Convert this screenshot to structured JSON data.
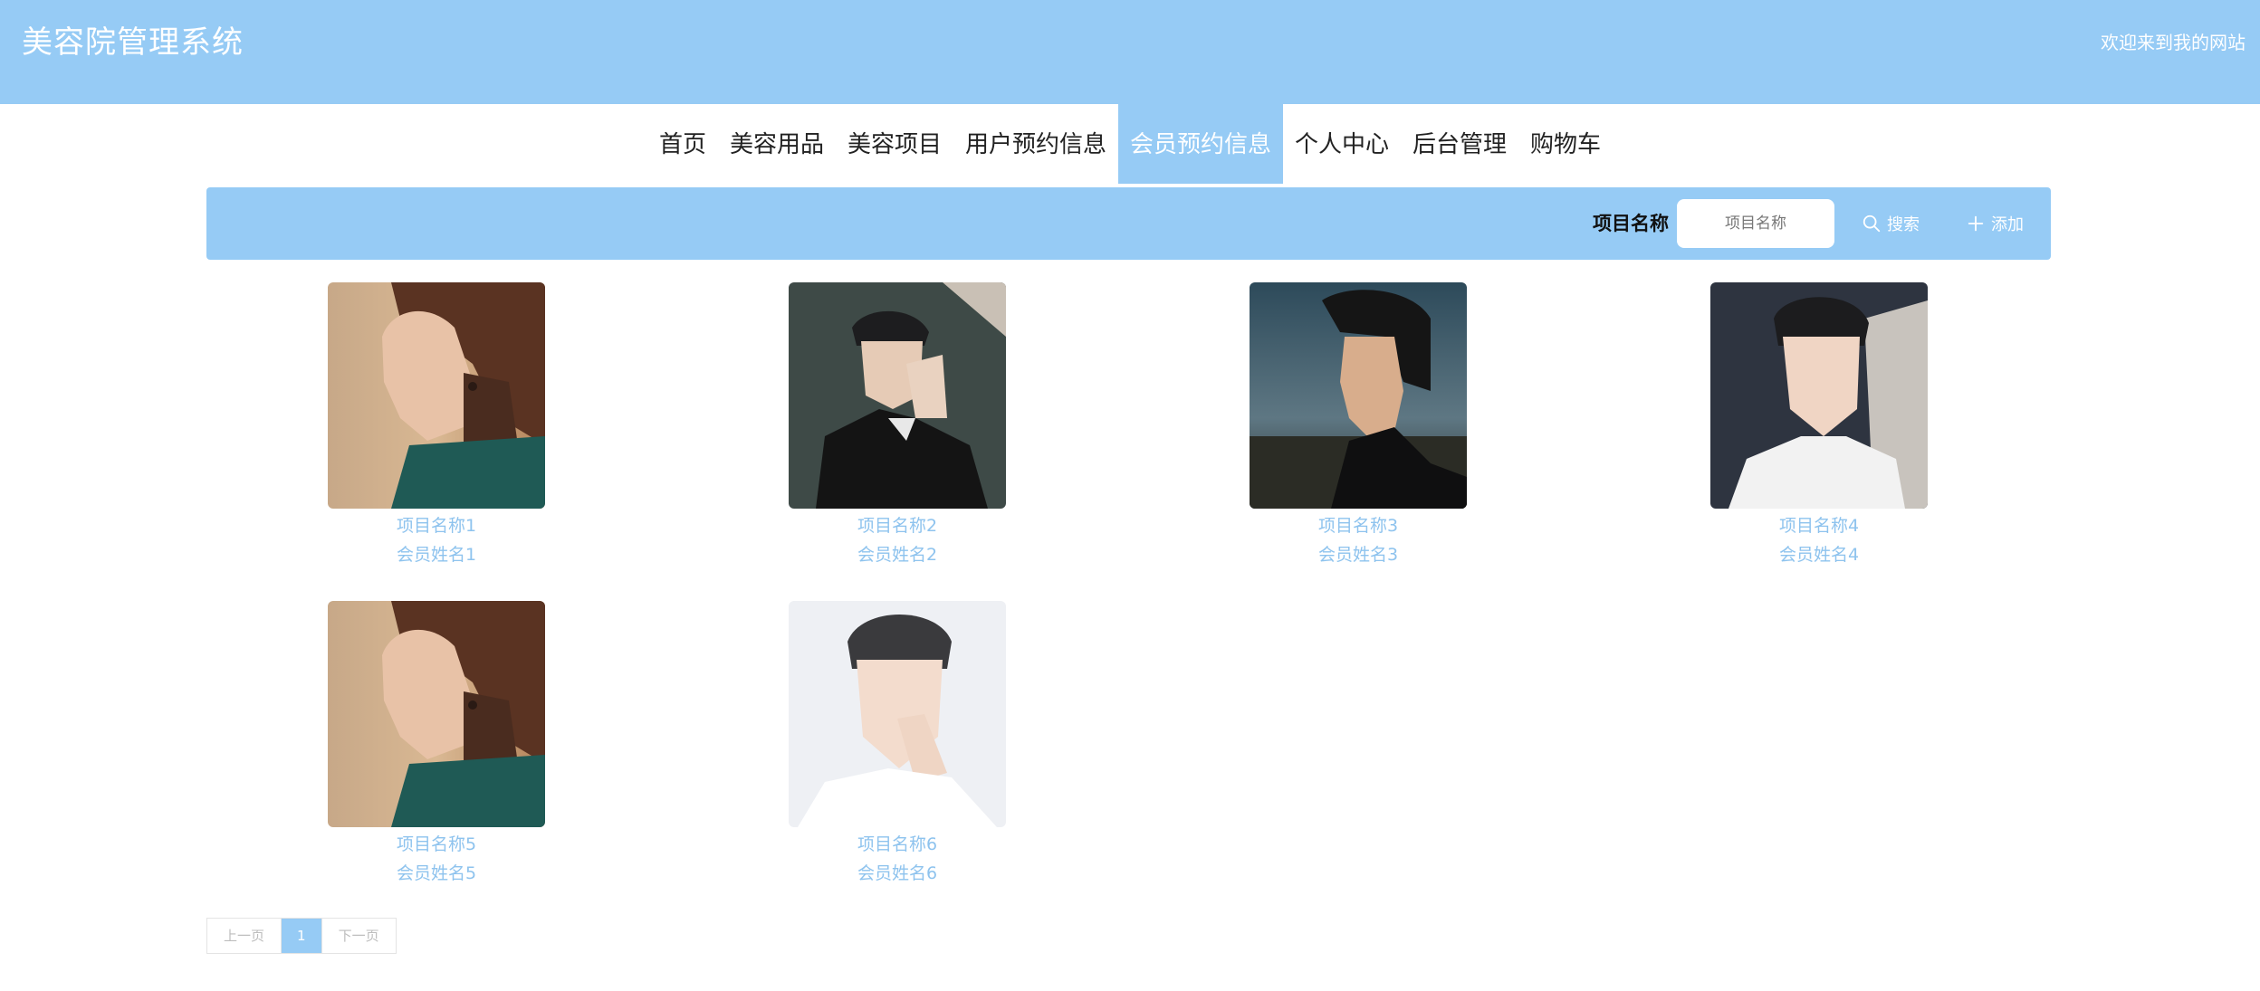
{
  "header": {
    "title": "美容院管理系统",
    "welcome": "欢迎来到我的网站"
  },
  "nav": {
    "items": [
      {
        "label": "首页"
      },
      {
        "label": "美容用品"
      },
      {
        "label": "美容项目"
      },
      {
        "label": "用户预约信息"
      },
      {
        "label": "会员预约信息"
      },
      {
        "label": "个人中心"
      },
      {
        "label": "后台管理"
      },
      {
        "label": "购物车"
      }
    ],
    "active": "会员预约信息"
  },
  "search": {
    "label": "项目名称",
    "placeholder": "项目名称",
    "search_label": "搜索",
    "add_label": "添加",
    "search_icon": "search-icon",
    "add_icon": "plus-icon"
  },
  "cards": [
    {
      "project": "项目名称1",
      "member": "会员姓名1",
      "photo": "woman-side-profile-photo"
    },
    {
      "project": "项目名称2",
      "member": "会员姓名2",
      "photo": "man-hand-on-cheek-photo"
    },
    {
      "project": "项目名称3",
      "member": "会员姓名3",
      "photo": "man-profile-sunset-photo"
    },
    {
      "project": "项目名称4",
      "member": "会员姓名4",
      "photo": "man-car-selfie-photo"
    },
    {
      "project": "项目名称5",
      "member": "会员姓名5",
      "photo": "woman-side-profile-photo"
    },
    {
      "project": "项目名称6",
      "member": "会员姓名6",
      "photo": "man-finger-on-lip-photo"
    }
  ],
  "pagination": {
    "prev": "上一页",
    "current": "1",
    "next": "下一页"
  },
  "colors": {
    "accent": "#96cbf5",
    "card_text": "#8ec3ee",
    "white": "#ffffff"
  }
}
